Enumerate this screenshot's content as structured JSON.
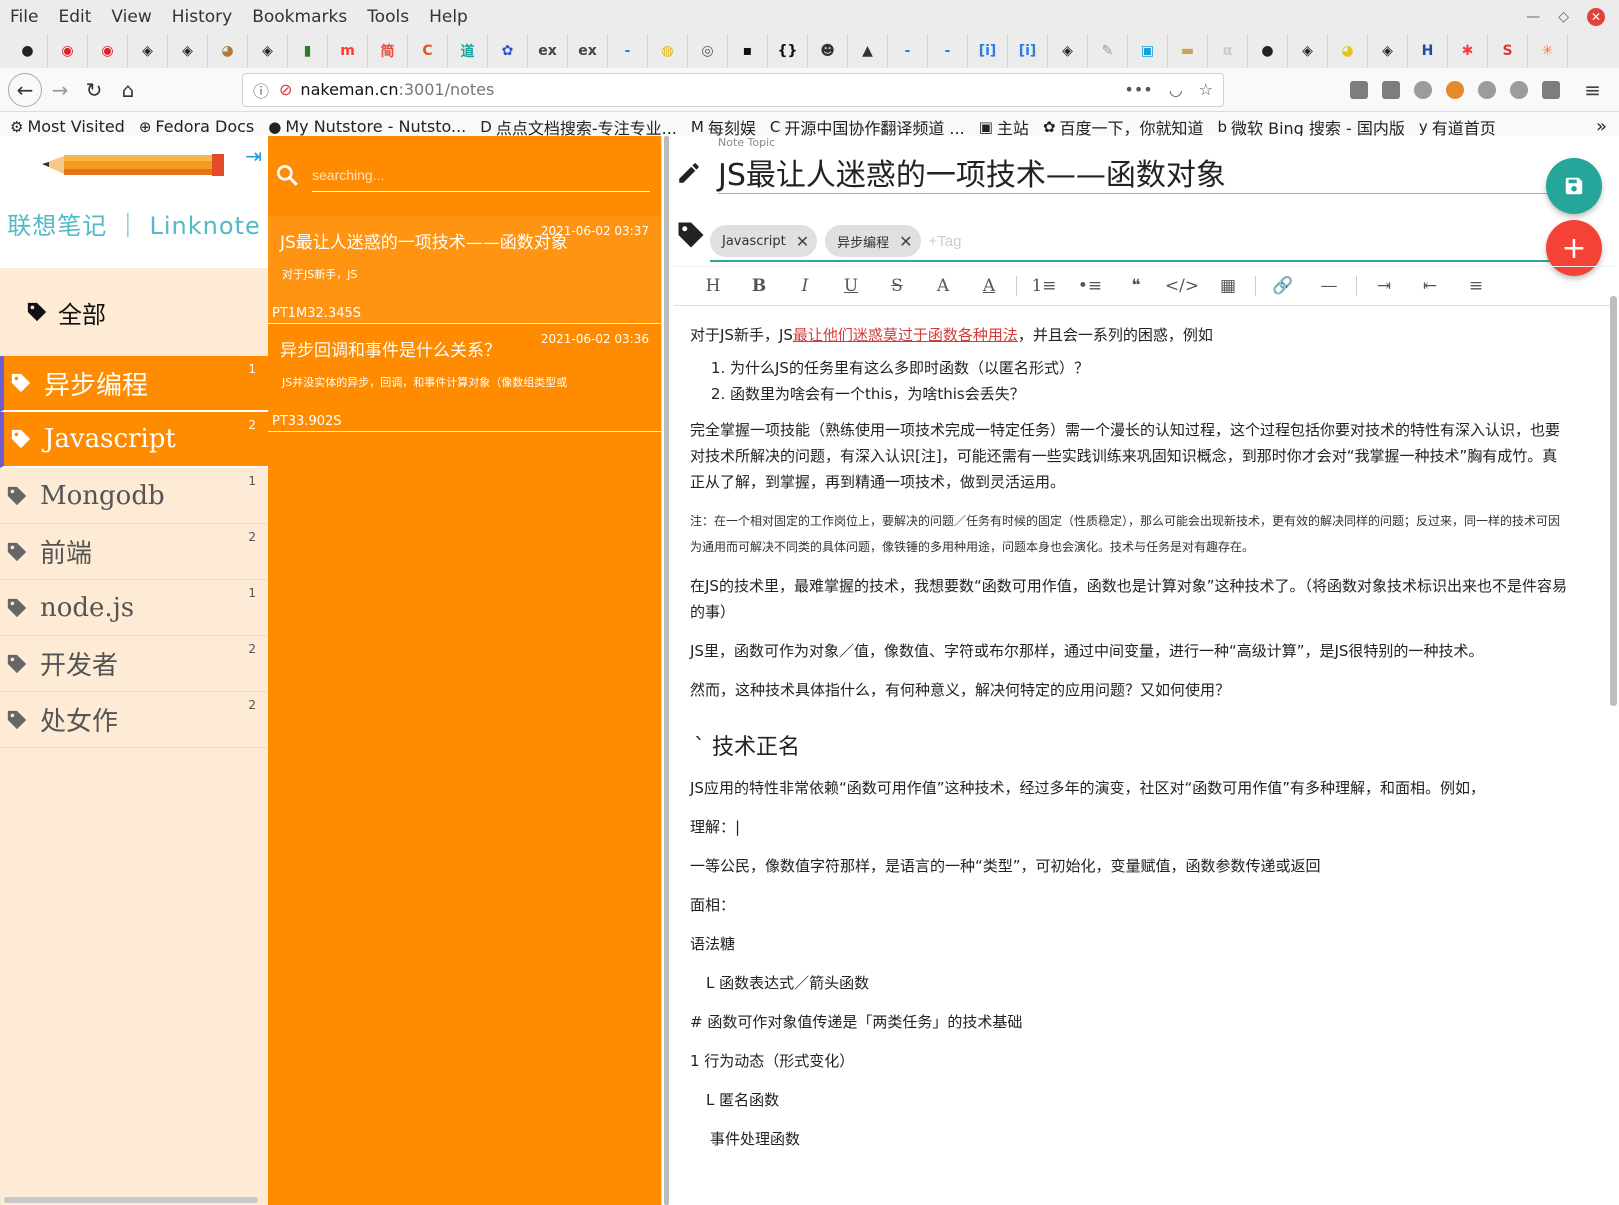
{
  "browser": {
    "menu": [
      "File",
      "Edit",
      "View",
      "History",
      "Bookmarks",
      "Tools",
      "Help"
    ],
    "tab_icons": [
      {
        "name": "github-tab-icon",
        "glyph": "●",
        "color": "#222"
      },
      {
        "name": "netease-tab-icon",
        "glyph": "◉",
        "color": "#e02020"
      },
      {
        "name": "netease-tab-icon",
        "glyph": "◉",
        "color": "#e02020"
      },
      {
        "name": "circle-tab-icon",
        "glyph": "◈",
        "color": "#222"
      },
      {
        "name": "circle-tab-icon",
        "glyph": "◈",
        "color": "#222"
      },
      {
        "name": "pug-tab-icon",
        "glyph": "◕",
        "color": "#b07a3a"
      },
      {
        "name": "circle-tab-icon",
        "glyph": "◈",
        "color": "#222"
      },
      {
        "name": "mongodb-tab-icon",
        "glyph": "▮",
        "color": "#2a7d2a"
      },
      {
        "name": "m-tab-icon",
        "glyph": "m",
        "color": "#ff3b30"
      },
      {
        "name": "jianshu-tab-icon",
        "glyph": "简",
        "color": "#e74c3c"
      },
      {
        "name": "c-tab-icon",
        "glyph": "C",
        "color": "#e8541e"
      },
      {
        "name": "doc-tab-icon",
        "glyph": "道",
        "color": "#1aa59a"
      },
      {
        "name": "baidu-tab-icon",
        "glyph": "✿",
        "color": "#2953d6"
      },
      {
        "name": "ex-tab-icon",
        "glyph": "ex",
        "color": "#444"
      },
      {
        "name": "ex-tab-icon",
        "glyph": "ex",
        "color": "#444"
      },
      {
        "name": "dash-tab-icon",
        "glyph": "-",
        "color": "#2d7dde"
      },
      {
        "name": "minion-tab-icon",
        "glyph": "◍",
        "color": "#e3b21a"
      },
      {
        "name": "globe-tab-icon",
        "glyph": "◎",
        "color": "#555"
      },
      {
        "name": "terminal-tab-icon",
        "glyph": "▪",
        "color": "#111"
      },
      {
        "name": "braces-tab-icon",
        "glyph": "{}",
        "color": "#111"
      },
      {
        "name": "avatar-tab-icon",
        "glyph": "☻",
        "color": "#333"
      },
      {
        "name": "warning-tab-icon",
        "glyph": "▲",
        "color": "#333"
      },
      {
        "name": "dash-tab-icon",
        "glyph": "-",
        "color": "#2d7dde"
      },
      {
        "name": "dash-tab-icon",
        "glyph": "-",
        "color": "#2d7dde"
      },
      {
        "name": "info-tab-icon",
        "glyph": "[i]",
        "color": "#2d7dde"
      },
      {
        "name": "info-tab-icon",
        "glyph": "[i]",
        "color": "#2d7dde"
      },
      {
        "name": "circle-tab-icon",
        "glyph": "◈",
        "color": "#222"
      },
      {
        "name": "pencil-tab-icon",
        "glyph": "✎",
        "color": "#999"
      },
      {
        "name": "bilibili-tab-icon",
        "glyph": "▣",
        "color": "#1aa1d9"
      },
      {
        "name": "box-tab-icon",
        "glyph": "▬",
        "color": "#c8a35a"
      },
      {
        "name": "alpha-tab-icon",
        "glyph": "α",
        "color": "#ccc"
      },
      {
        "name": "github-tab-icon",
        "glyph": "●",
        "color": "#222"
      },
      {
        "name": "circle-tab-icon",
        "glyph": "◈",
        "color": "#222"
      },
      {
        "name": "yellow-tab-icon",
        "glyph": "◕",
        "color": "#e3c41a"
      },
      {
        "name": "circle-tab-icon",
        "glyph": "◈",
        "color": "#222"
      },
      {
        "name": "h-tab-icon",
        "glyph": "H",
        "color": "#1f4aa8"
      },
      {
        "name": "star-tab-icon",
        "glyph": "✱",
        "color": "#e44"
      },
      {
        "name": "s-tab-icon",
        "glyph": "S",
        "color": "#e03a3a"
      },
      {
        "name": "hubspot-tab-icon",
        "glyph": "✳",
        "color": "#ff7a3a"
      }
    ],
    "url_host": "nakeman.cn",
    "url_path": ":3001/notes",
    "bookmarks": [
      {
        "icon": "⚙",
        "label": "Most Visited"
      },
      {
        "icon": "⊕",
        "label": "Fedora Docs"
      },
      {
        "icon": "●",
        "label": "My Nutstore - Nutsto..."
      },
      {
        "icon": "D",
        "label": "点点文档搜索-专注专业..."
      },
      {
        "icon": "M",
        "label": "每刻娱"
      },
      {
        "icon": "C",
        "label": "开源中国协作翻译频道 ..."
      },
      {
        "icon": "▣",
        "label": "主站"
      },
      {
        "icon": "✿",
        "label": "百度一下，你就知道"
      },
      {
        "icon": "b",
        "label": "微软 Bing 搜索 - 国内版"
      },
      {
        "icon": "y",
        "label": "有道首页"
      }
    ]
  },
  "app": {
    "brand": "联想笔记 ｜ Linknote",
    "all_label": "全部",
    "tags": [
      {
        "label": "异步编程",
        "count": "1",
        "active": true
      },
      {
        "label": "Javascript",
        "count": "2",
        "active": true
      },
      {
        "label": "Mongodb",
        "count": "1",
        "active": false
      },
      {
        "label": "前端",
        "count": "2",
        "active": false
      },
      {
        "label": "node.js",
        "count": "1",
        "active": false
      },
      {
        "label": "开发者",
        "count": "2",
        "active": false
      },
      {
        "label": "处女作",
        "count": "2",
        "active": false
      }
    ],
    "search_placeholder": "searching...",
    "notes": [
      {
        "title": "JS最让人迷惑的一项技术——函数对象",
        "date": "2021-06-02 03:37",
        "summary": "对于JS新手，JS",
        "duration": "PT1M32.345S",
        "active": true
      },
      {
        "title": "异步回调和事件是什么关系？",
        "date": "2021-06-02 03:36",
        "summary": "JS并没实体的异步，回调，和事件计算对象（像数组类型或",
        "duration": "PT33.902S",
        "active": false
      }
    ],
    "editor": {
      "topic_label": "Note Topic",
      "title": "JS最让人迷惑的一项技术——函数对象",
      "tag_chips": [
        "Javascript",
        "异步编程"
      ],
      "tag_placeholder": "+Tag",
      "toolbar": [
        "H",
        "B",
        "I",
        "U",
        "S",
        "A",
        "A",
        "|",
        "1≡",
        "•≡",
        "❝",
        "</>",
        "▦",
        "|",
        "🔗",
        "—",
        "|",
        "⇥",
        "⇤",
        "≡"
      ],
      "content": {
        "p1_pre": "对于JS新手，JS",
        "p1_link": "最让他们迷惑莫过于函数各种用法",
        "p1_post": "，并且会一系列的困惑，例如",
        "list": [
          "为什么JS的任务里有这么多即时函数（以匿名形式）？",
          "函数里为啥会有一个this，为啥this会丢失？"
        ],
        "p2": "完全掌握一项技能（熟练使用一项技术完成一特定任务）需一个漫长的认知过程，这个过程包括你要对技术的特性有深入认识，也要对技术所解决的问题，有深入认识[注]，可能还需有一些实践训练来巩固知识概念，到那时你才会对“我掌握一种技术”胸有成竹。真正从了解，到掌握，再到精通一项技术，做到灵活运用。",
        "note": "注：在一个相对固定的工作岗位上，要解决的问题／任务有时候的固定（性质稳定），那么可能会出现新技术，更有效的解决同样的问题；反过来，同一样的技术可因为通用而可解决不同类的具体问题，像铁锤的多用种用途，问题本身也会演化。技术与任务是对有趣存在。",
        "p3": "在JS的技术里，最难掌握的技术，我想要数“函数可用作值，函数也是计算对象”这种技术了。（将函数对象技术标识出来也不是件容易的事）",
        "p4": "JS里，函数可作为对象／值，像数值、字符或布尔那样，通过中间变量，进行一种“高级计算”，是JS很特别的一种技术。",
        "p5": "然而，这种技术具体指什么，有何种意义，解决何特定的应用问题？又如何使用？",
        "h2": "`  技术正名",
        "p6": "JS应用的特性非常依赖“函数可用作值”这种技术，经过多年的演变，社区对“函数可用作值”有多种理解，和面相。例如，",
        "p7": "理解：|",
        "p8": "一等公民，像数值字符那样，是语言的一种“类型”，可初始化，变量赋值，函数参数传递或返回",
        "p9": "面相：",
        "p10": "语法糖",
        "p11": "L 函数表达式／箭头函数",
        "p12": "# 函数可作对象值传递是「两类任务」的技术基础",
        "p13": "1 行为动态（形式变化）",
        "p14": "L 匿名函数",
        "p15": "事件处理函数"
      }
    }
  },
  "colors": {
    "orange": "#fe8b00",
    "teal": "#26a69a",
    "red": "#f44336",
    "brand": "#52b9c6"
  }
}
